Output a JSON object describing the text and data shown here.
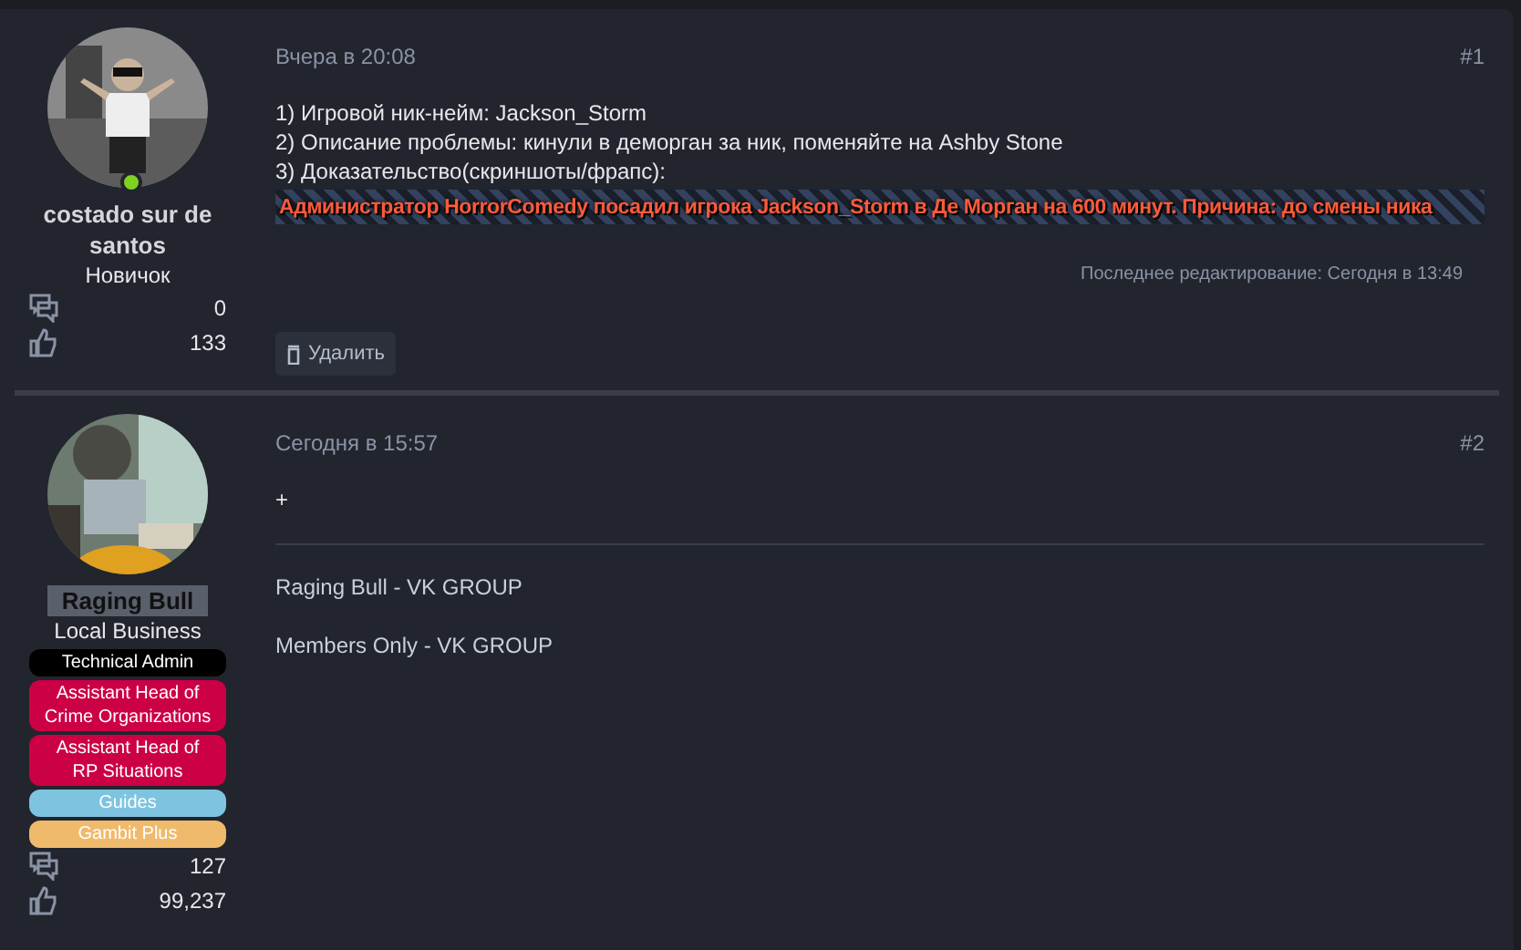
{
  "posts": [
    {
      "user": {
        "name": "costado sur de santos",
        "kind": "plain",
        "title": "Новичок",
        "online": true,
        "messages": "0",
        "reactions": "133"
      },
      "date": "Вчера в 20:08",
      "number": "#1",
      "lines": [
        "1) Игровой ник-нейм: Jackson_Storm",
        "2) Описание проблемы: кинули в деморган за ник, поменяйте на Ashby Stone",
        "3) Доказательство(скриншоты/фрапс):"
      ],
      "screenshot_text": "Администратор HorrorComedy посадил игрока Jackson_Storm в Де Морган на 600 минут. Причина: до смены ника",
      "last_edit": "Последнее редактирование: Сегодня в 13:49",
      "actions": [
        "Удалить"
      ]
    },
    {
      "user": {
        "name": "Raging Bull",
        "kind": "dark",
        "title": "Local Business",
        "online": false,
        "banners": [
          {
            "label": "Technical Admin",
            "color": "#000000"
          },
          {
            "label": "Assistant Head of Crime Organizations",
            "color": "#cc0044"
          },
          {
            "label": "Assistant Head of RP Situations",
            "color": "#cc0044"
          },
          {
            "label": "Guides",
            "color": "#7ec4e0"
          },
          {
            "label": "Gambit Plus",
            "color": "#f0ba6c"
          }
        ],
        "messages": "127",
        "reactions": "99,237"
      },
      "date": "Сегодня в 15:57",
      "number": "#2",
      "lines": [
        "+"
      ],
      "signature": [
        "Raging Bull - VK GROUP",
        "Members Only - VK GROUP"
      ]
    }
  ]
}
